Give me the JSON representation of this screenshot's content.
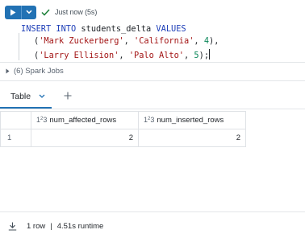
{
  "toolbar": {
    "run_icon": "play-icon",
    "caret_icon": "chevron-down-icon",
    "status_icon": "check-icon",
    "status_text": "Just now (5s)",
    "run_color": "#2272b4",
    "status_color": "#1a7f37"
  },
  "code": {
    "line1": {
      "kw1": "INSERT",
      "kw2": "INTO",
      "table": "students_delta",
      "kw3": "VALUES"
    },
    "line2": {
      "open": "(",
      "s1": "'Mark Zuckerberg'",
      "c1": ", ",
      "s2": "'California'",
      "c2": ", ",
      "n": "4",
      "close": "),"
    },
    "line3": {
      "open": "(",
      "s1": "'Larry Ellision'",
      "c1": ", ",
      "s2": "'Palo Alto'",
      "c2": ", ",
      "n": "5",
      "close": ");"
    }
  },
  "spark_jobs": {
    "label": "(6) Spark Jobs"
  },
  "tabs": {
    "active": "Table",
    "add_icon": "plus-icon"
  },
  "table": {
    "columns": [
      {
        "type": "1²3",
        "name": "num_affected_rows"
      },
      {
        "type": "1²3",
        "name": "num_inserted_rows"
      }
    ],
    "rows": [
      {
        "index": "1",
        "values": [
          "2",
          "2"
        ]
      }
    ]
  },
  "footer": {
    "download_icon": "download-icon",
    "rows": "1 row",
    "separator": "|",
    "runtime": "4.51s runtime"
  }
}
